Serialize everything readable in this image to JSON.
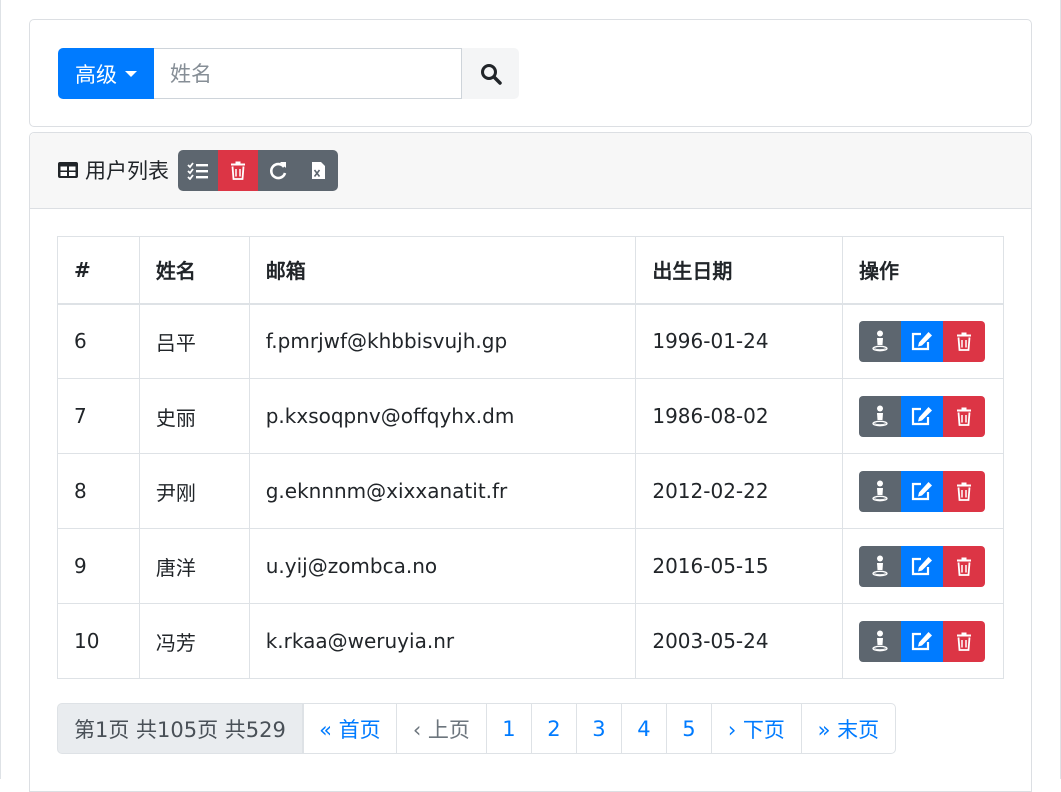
{
  "search": {
    "advanced_label": "高级",
    "placeholder": "姓名",
    "value": ""
  },
  "list": {
    "title": "用户列表",
    "columns": [
      "#",
      "姓名",
      "邮箱",
      "出生日期",
      "操作"
    ],
    "rows": [
      {
        "id": "6",
        "name": "吕平",
        "email": "f.pmrjwf@khbbisvujh.gp",
        "birth": "1996-01-24"
      },
      {
        "id": "7",
        "name": "史丽",
        "email": "p.kxsoqpnv@offqyhx.dm",
        "birth": "1986-08-02"
      },
      {
        "id": "8",
        "name": "尹刚",
        "email": "g.eknnnm@xixxanatit.fr",
        "birth": "2012-02-22"
      },
      {
        "id": "9",
        "name": "唐洋",
        "email": "u.yij@zombca.no",
        "birth": "2016-05-15"
      },
      {
        "id": "10",
        "name": "冯芳",
        "email": "k.rkaa@weruyia.nr",
        "birth": "2003-05-24"
      }
    ]
  },
  "pagination": {
    "info": "第1页 共105页 共529",
    "first": "« 首页",
    "prev": "‹ 上页",
    "pages": [
      "1",
      "2",
      "3",
      "4",
      "5"
    ],
    "next": "› 下页",
    "last": "» 末页"
  },
  "colors": {
    "primary": "#007bff",
    "danger": "#dc3545",
    "secondary": "#5d666f"
  },
  "icons": {
    "search": "search-icon",
    "table": "table-icon",
    "checklist": "checklist-icon",
    "trash": "trash-icon",
    "refresh": "refresh-icon",
    "excel": "excel-file-icon",
    "user": "user-icon",
    "edit": "edit-icon"
  }
}
